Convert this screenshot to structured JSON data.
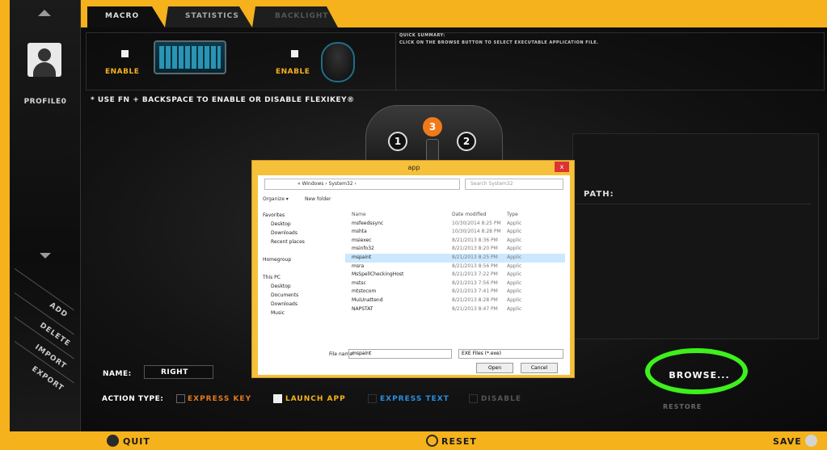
{
  "tabs": [
    "MACRO",
    "STATISTICS",
    "BACKLIGHT"
  ],
  "sidebar": {
    "profile_label": "PROFILE0",
    "actions": [
      "ADD",
      "DELETE",
      "IMPORT",
      "EXPORT"
    ]
  },
  "top": {
    "enable_keyboard": "ENABLE",
    "enable_mouse": "ENABLE",
    "quick_title": "QUICK SUMMARY:",
    "quick_text": "CLICK ON THE BROWSE BUTTON TO SELECT EXECUTABLE APPLICATION FILE.",
    "flexikey_note": "* USE FN + BACKSPACE TO ENABLE OR DISABLE FLEXIKEY®"
  },
  "mouse_buttons": [
    "1",
    "3",
    "2"
  ],
  "path_label": "PATH:",
  "name_label": "NAME:",
  "name_value": "RIGHT",
  "action_type_label": "ACTION TYPE:",
  "action_options": [
    "EXPRESS KEY",
    "LAUNCH APP",
    "EXPRESS TEXT",
    "DISABLE"
  ],
  "browse_label": "BROWSE...",
  "restore_label": "RESTORE",
  "bottom": {
    "quit": "QUIT",
    "reset": "RESET",
    "save": "SAVE"
  },
  "dialog": {
    "title": "app",
    "close": "x",
    "address": "« Windows › System32 ›",
    "search_placeholder": "Search System32",
    "organize": "Organize ▾",
    "new_folder": "New folder",
    "nav": [
      "Favorites",
      "Desktop",
      "Downloads",
      "Recent places",
      "",
      "Homegroup",
      "",
      "This PC",
      "Desktop",
      "Documents",
      "Downloads",
      "Music"
    ],
    "columns": [
      "Name",
      "Date modified",
      "Type"
    ],
    "files": [
      {
        "name": "msfeedssync",
        "date": "10/30/2014 8:25 PM",
        "type": "Applic"
      },
      {
        "name": "mshta",
        "date": "10/30/2014 8:28 PM",
        "type": "Applic"
      },
      {
        "name": "msiexec",
        "date": "8/21/2013 8:36 PM",
        "type": "Applic"
      },
      {
        "name": "msinfo32",
        "date": "8/21/2013 8:20 PM",
        "type": "Applic"
      },
      {
        "name": "mspaint",
        "date": "8/21/2013 8:25 PM",
        "type": "Applic"
      },
      {
        "name": "msra",
        "date": "8/21/2013 8:56 PM",
        "type": "Applic"
      },
      {
        "name": "MsSpellCheckingHost",
        "date": "8/21/2013 7:22 PM",
        "type": "Applic"
      },
      {
        "name": "mstsc",
        "date": "8/21/2013 7:56 PM",
        "type": "Applic"
      },
      {
        "name": "mtstocom",
        "date": "8/21/2013 7:41 PM",
        "type": "Applic"
      },
      {
        "name": "MuiUnattend",
        "date": "8/21/2013 8:28 PM",
        "type": "Applic"
      },
      {
        "name": "NAPSTAT",
        "date": "8/21/2013 8:47 PM",
        "type": "Applic"
      }
    ],
    "file_name_label": "File name:",
    "file_name_value": "mspaint",
    "file_type": "EXE Files (*.exe)",
    "open": "Open",
    "cancel": "Cancel"
  },
  "colors": {
    "accent": "#f5b21c",
    "highlight_ring": "#3ef01c",
    "active_button": "#f07a1a",
    "express_text": "#2a8fe0",
    "express_key": "#e07a20",
    "launch_app": "#f5b21c"
  }
}
